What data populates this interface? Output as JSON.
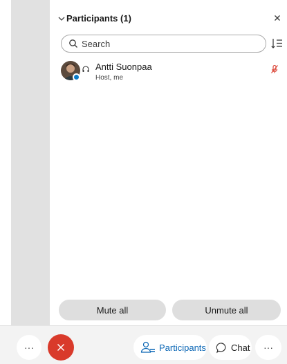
{
  "panel": {
    "title": "Participants (1)",
    "search_placeholder": "Search"
  },
  "participants": [
    {
      "name": "Antti Suonpaa",
      "role": "Host, me"
    }
  ],
  "actions": {
    "mute_all": "Mute all",
    "unmute_all": "Unmute all"
  },
  "toolbar": {
    "more_left": "···",
    "participants_label": "Participants",
    "chat_label": "Chat",
    "more_right": "···"
  },
  "icons": {
    "collapse": "chevron-down-icon",
    "close": "close-icon",
    "search": "search-icon",
    "sort": "sort-icon",
    "headset": "headset-icon",
    "mic": "mic-muted-icon",
    "end_call": "end-call-icon",
    "participants": "person-icon",
    "chat": "chat-bubble-icon"
  },
  "colors": {
    "accent": "#0a66b5",
    "end_call": "#d93a2b",
    "muted_mic": "#d93a2b",
    "status_online": "#0a7bc7"
  }
}
